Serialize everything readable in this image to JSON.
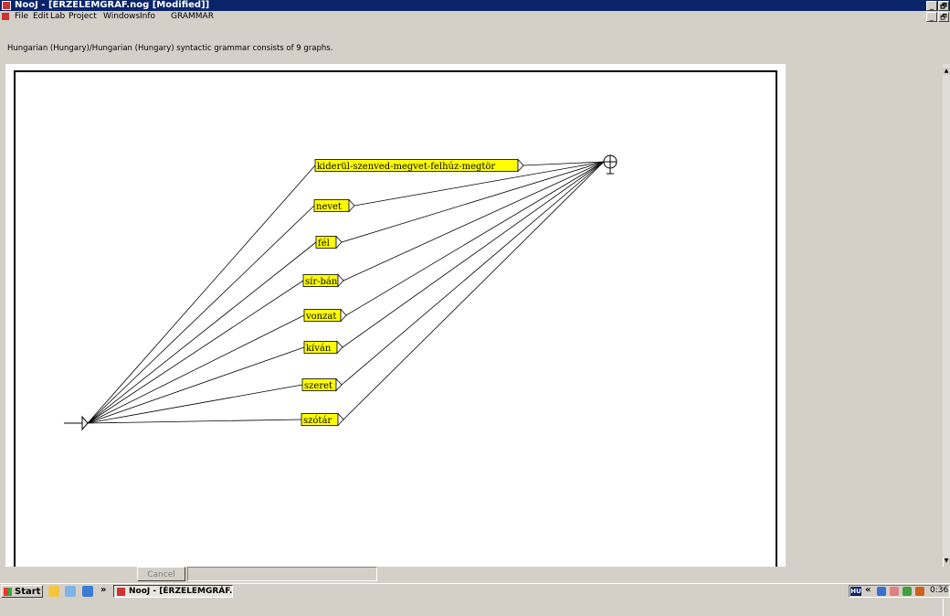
{
  "window": {
    "title": "NooJ - [ÉRZELEMGRÁF.nog [Modified]]",
    "controls": [
      "_",
      "🗗",
      "✕"
    ]
  },
  "menu": {
    "items": [
      "File",
      "Edit",
      "Lab",
      "Project",
      "Windows",
      "Info",
      "GRAMMAR"
    ],
    "controls": [
      "_",
      "🗗",
      "✕"
    ]
  },
  "info_text": "Hungarian (Hungary)/Hungarian (Hungary) syntactic grammar consists of 9 graphs.",
  "graph": {
    "nodes": [
      "kiderül-szenved-megvet-felhúz-megtör",
      "nevet",
      "fél",
      "sír-bán",
      "vonzat",
      "kíván",
      "szeret",
      "szótár"
    ]
  },
  "status": {
    "cancel_label": "Cancel"
  },
  "taskbar": {
    "start_label": "Start",
    "overflow": "»",
    "task_label": "NooJ - [ÉRZELEMGRÁF...",
    "lang": "HU",
    "tray_chevron": "«",
    "clock": "0:36"
  }
}
